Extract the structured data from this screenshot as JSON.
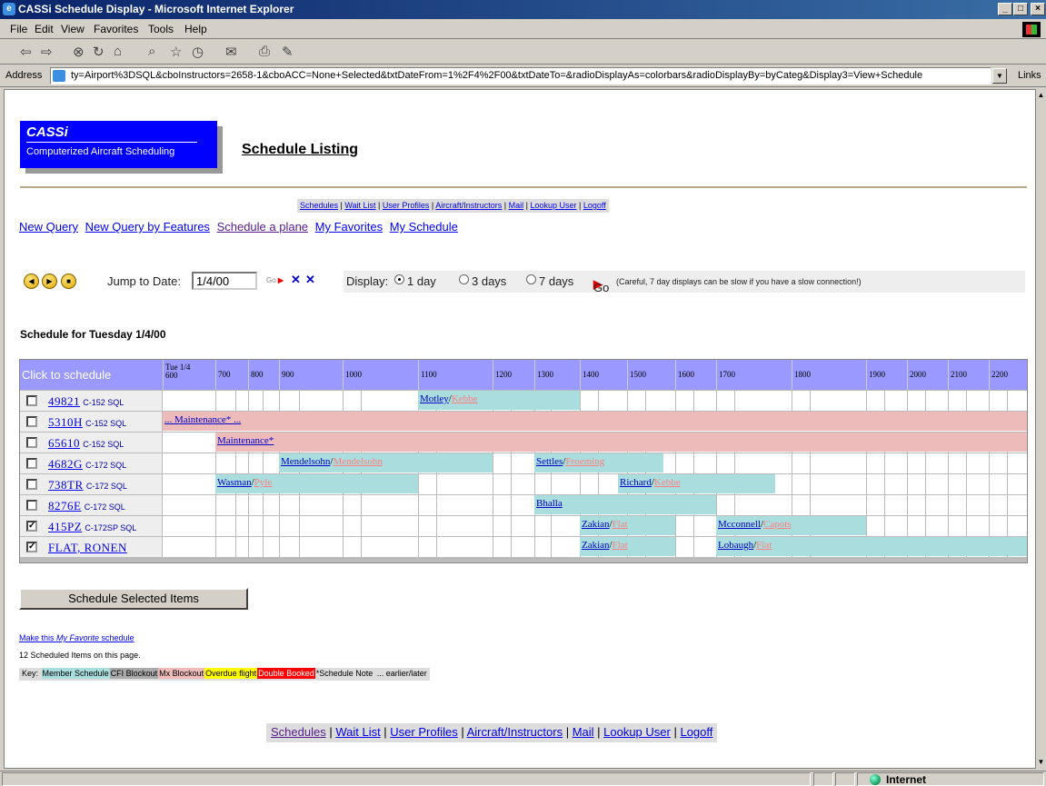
{
  "window": {
    "title": "CASSi Schedule Display - Microsoft Internet Explorer",
    "minimize": "_",
    "restore": "□",
    "close": "×"
  },
  "menu": [
    "File",
    "Edit",
    "View",
    "Favorites",
    "Tools",
    "Help"
  ],
  "toolbar": {
    "back": "⇦",
    "forward": "⇨",
    "stop": "⊗",
    "refresh": "↻",
    "home": "⌂",
    "search": "⌕",
    "favorites": "☆",
    "history": "◷",
    "mail": "✉",
    "print": "⎙",
    "edit": "✎"
  },
  "address": {
    "label": "Address",
    "value": "ty=Airport%3DSQL&cboInstructors=2658-1&cboACC=None+Selected&txtDateFrom=1%2F4%2F00&txtDateTo=&radioDisplayAs=colorbars&radioDisplayBy=byCateg&Display3=View+Schedule",
    "links": "Links"
  },
  "logo": {
    "name": "CASSi",
    "tagline": "Computerized Aircraft Scheduling"
  },
  "page_title": "Schedule Listing",
  "top_nav": [
    "Schedules",
    "Wait List",
    "User Profiles",
    "Aircraft/Instructors",
    "Mail",
    "Lookup User",
    "Logoff"
  ],
  "query_links": [
    "New Query",
    "New Query by Features",
    "Schedule a plane",
    "My Favorites",
    "My Schedule"
  ],
  "controls": {
    "jump_label": "Jump to Date:",
    "date_value": "1/4/00",
    "go": "Go",
    "display_label": "Display:",
    "opt_1day": "1 day",
    "opt_3days": "3 days",
    "opt_7days": "7 days",
    "selected": "1 day",
    "warning": "(Careful, 7 day displays can be slow if you have a slow connection!)"
  },
  "schedule_header": "Schedule for Tuesday 1/4/00",
  "grid": {
    "click_label": "Click to schedule",
    "first_col": [
      "Tue 1/4",
      "600"
    ],
    "hours": [
      "700",
      "800",
      "900",
      "1000",
      "1100",
      "1200",
      "1300",
      "1400",
      "1500",
      "1600",
      "1700",
      "1800",
      "1900",
      "2000",
      "2100",
      "2200"
    ],
    "rows": [
      {
        "tail": "49821",
        "type": "C-152 SQL",
        "checked": false
      },
      {
        "tail": "5310H",
        "type": "C-152 SQL",
        "checked": false
      },
      {
        "tail": "65610",
        "type": "C-152 SQL",
        "checked": false
      },
      {
        "tail": "4682G",
        "type": "C-172 SQL",
        "checked": false
      },
      {
        "tail": "738TR",
        "type": "C-172 SQL",
        "checked": false
      },
      {
        "tail": "8276E",
        "type": "C-172 SQL",
        "checked": false
      },
      {
        "tail": "415PZ",
        "type": "C-172SP SQL",
        "checked": true
      },
      {
        "tail": "FLAT, RONEN",
        "type": "",
        "checked": true
      }
    ],
    "bookings": {
      "r0a": {
        "who": "Motley",
        "cfi": "Kebbe"
      },
      "r1a": {
        "text": "... Maintenance* ..."
      },
      "r2a": {
        "text": "Maintenance*"
      },
      "r3a": {
        "who": "Mendelsohn",
        "cfi": "Mendelsohn"
      },
      "r3b": {
        "who": "Settles",
        "cfi": "Froeming"
      },
      "r4a": {
        "who": "Wasman",
        "cfi": "Pyle"
      },
      "r4b": {
        "who": "Richard",
        "cfi": "Kebbe"
      },
      "r5a": {
        "who": "Bhalla"
      },
      "r6a": {
        "who": "Zakian",
        "cfi": "Flat"
      },
      "r6b": {
        "who": "Mcconnell",
        "cfi": "Capots"
      },
      "r7a": {
        "who": "Zakian",
        "cfi": "Flat"
      },
      "r7b": {
        "who": "Lobaugh",
        "cfi": "Flat"
      }
    }
  },
  "schedule_button": "Schedule Selected Items",
  "favorite": {
    "pre": "Make this ",
    "em": "My Favorite",
    "post": " schedule"
  },
  "count_line": "12 Scheduled Items on this page.",
  "key": {
    "label": "Key:",
    "items": [
      {
        "text": "Member Schedule",
        "color": "#aadddd",
        "fg": "#000000"
      },
      {
        "text": "CFI Blockout",
        "color": "#aaaaaa",
        "fg": "#000000"
      },
      {
        "text": "Mx Blockout",
        "color": "#eebbbb",
        "fg": "#000000"
      },
      {
        "text": "Overdue flight",
        "color": "#ffff00",
        "fg": "#000000"
      },
      {
        "text": "Double Booked",
        "color": "#ff0000",
        "fg": "#ffffff"
      },
      {
        "text": "*Schedule Note",
        "color": "#dddddd",
        "fg": "#000000"
      },
      {
        "text": "... earlier/later",
        "color": "#dddddd",
        "fg": "#000000"
      }
    ]
  },
  "bottom_nav": [
    "Schedules",
    "Wait List",
    "User Profiles",
    "Aircraft/Instructors",
    "Mail",
    "Lookup User",
    "Logoff"
  ],
  "status": {
    "zone": "Internet"
  }
}
